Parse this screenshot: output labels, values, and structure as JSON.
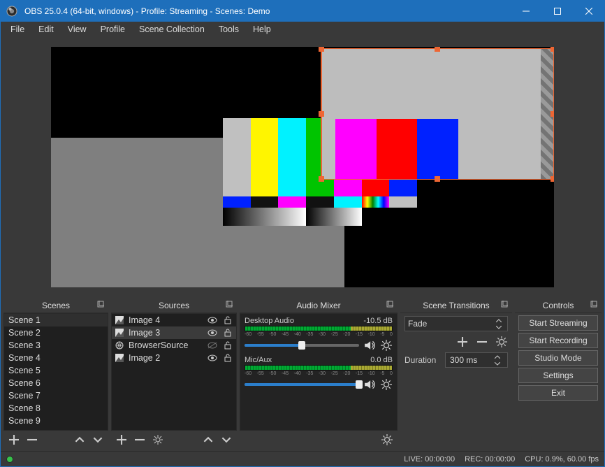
{
  "window": {
    "title": "OBS 25.0.4 (64-bit, windows) - Profile: Streaming - Scenes: Demo"
  },
  "menubar": [
    "File",
    "Edit",
    "View",
    "Profile",
    "Scene Collection",
    "Tools",
    "Help"
  ],
  "panels": {
    "scenes": {
      "title": "Scenes",
      "items": [
        "Scene 1",
        "Scene 2",
        "Scene 3",
        "Scene 4",
        "Scene 5",
        "Scene 6",
        "Scene 7",
        "Scene 8",
        "Scene 9"
      ],
      "selected_index": 0
    },
    "sources": {
      "title": "Sources",
      "items": [
        {
          "label": "Image 4",
          "type": "image",
          "visible": true,
          "locked": false
        },
        {
          "label": "Image 3",
          "type": "image",
          "visible": true,
          "locked": false
        },
        {
          "label": "BrowserSource",
          "type": "browser",
          "visible": false,
          "locked": false
        },
        {
          "label": "Image 2",
          "type": "image",
          "visible": true,
          "locked": false
        }
      ],
      "selected_index": 1
    },
    "mixer": {
      "title": "Audio Mixer",
      "channels": [
        {
          "name": "Desktop Audio",
          "level_db": "-10.5 dB",
          "vol_pct": 50
        },
        {
          "name": "Mic/Aux",
          "level_db": "0.0 dB",
          "vol_pct": 100
        }
      ],
      "scale_ticks": [
        "-60",
        "-55",
        "-50",
        "-45",
        "-40",
        "-35",
        "-30",
        "-25",
        "-20",
        "-15",
        "-10",
        "-5",
        "0"
      ]
    },
    "transitions": {
      "title": "Scene Transitions",
      "current": "Fade",
      "duration_label": "Duration",
      "duration_value": "300 ms"
    },
    "controls": {
      "title": "Controls",
      "buttons": [
        "Start Streaming",
        "Start Recording",
        "Studio Mode",
        "Settings",
        "Exit"
      ]
    }
  },
  "statusbar": {
    "live": "LIVE: 00:00:00",
    "rec": "REC: 00:00:00",
    "cpu": "CPU: 0.9%, 60.00 fps"
  }
}
